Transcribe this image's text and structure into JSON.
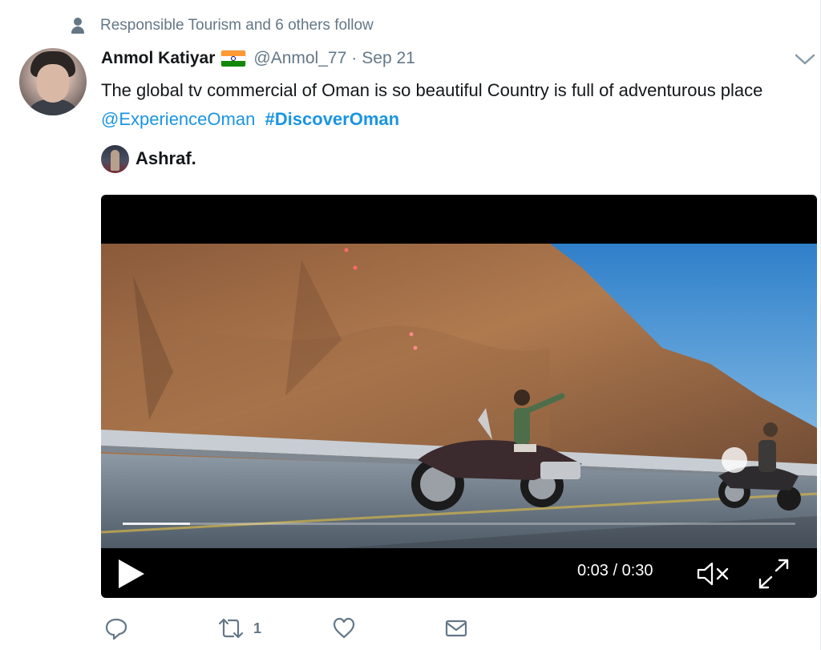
{
  "social_context": {
    "text": "Responsible Tourism and 6 others follow",
    "icon": "person-icon"
  },
  "tweet": {
    "author_name": "Anmol Katiyar",
    "author_flag": "india-flag-icon",
    "author_handle": "@Anmol_77",
    "separator": "·",
    "date": "Sep 21",
    "text_parts": {
      "body": "The global tv commercial of Oman is so beautiful Country is full of adventurous place ",
      "mention": "@ExperienceOman",
      "hashtag": "#DiscoverOman"
    },
    "media_source_name": "Ashraf."
  },
  "video": {
    "time_display": "0:03 / 0:30",
    "progress_fraction": 0.1,
    "muted": true
  },
  "actions": {
    "reply_count": "",
    "retweet_count": "1",
    "like_count": "",
    "icons": [
      "reply-icon",
      "retweet-icon",
      "like-icon",
      "direct-message-icon"
    ]
  },
  "colors": {
    "link": "#1b95e0",
    "secondary_text": "#657786",
    "primary_text": "#14171a"
  }
}
